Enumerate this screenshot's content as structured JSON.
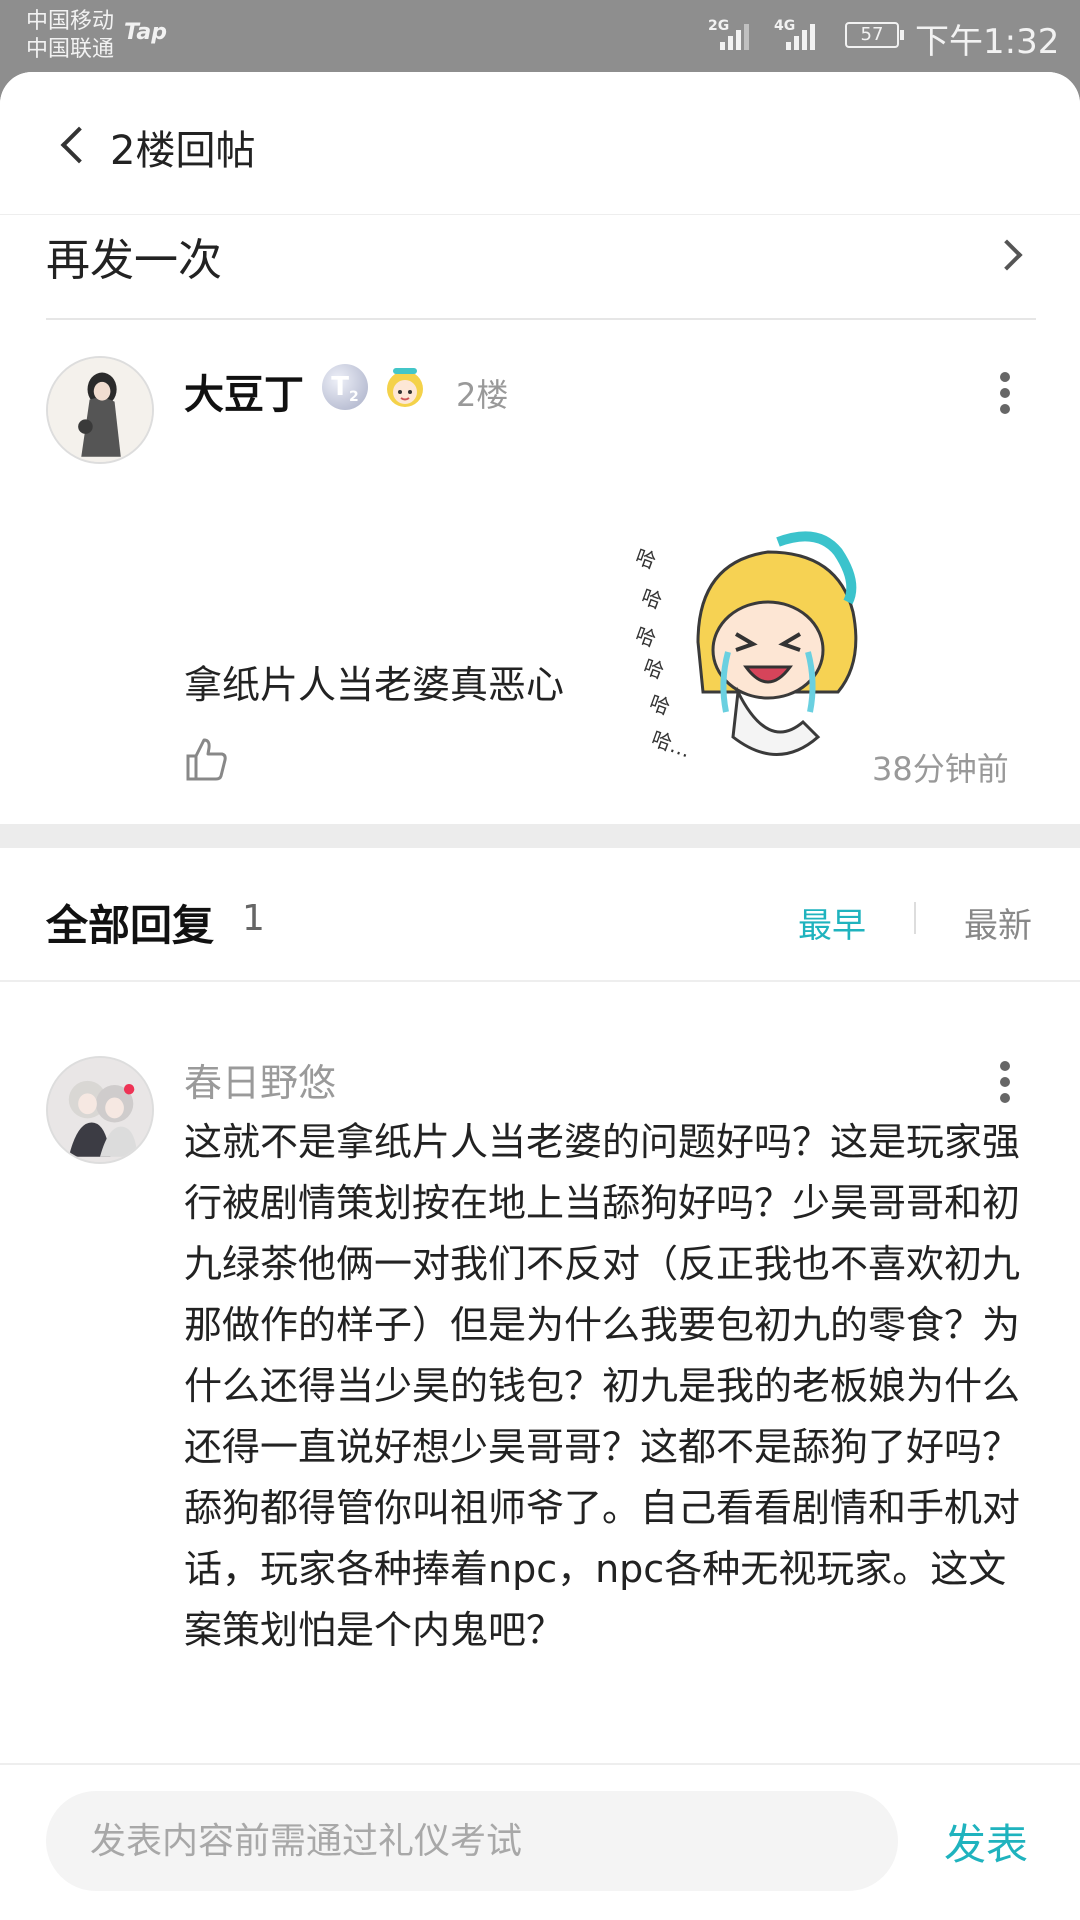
{
  "status_bar": {
    "carrier1": "中国移动",
    "carrier2": "中国联通",
    "app_badge": "Tap",
    "signal1_label": "2G",
    "signal2_label": "4G",
    "battery": "57",
    "time": "下午1:32"
  },
  "header": {
    "title": "2楼回帖",
    "back_icon": "chevron-left-icon"
  },
  "resend": {
    "label": "再发一次",
    "icon": "chevron-right-icon"
  },
  "post": {
    "author": "大豆丁",
    "badge": "T",
    "badge_sub": "2",
    "floor": "2楼",
    "text": "拿纸片人当老婆真恶心",
    "time": "38分钟前",
    "sticker_text": "哈哈哈哈哈哈…"
  },
  "replies": {
    "title": "全部回复",
    "count": "1",
    "sort_earliest": "最早",
    "sort_newest": "最新",
    "items": [
      {
        "author": "春日野悠",
        "text": "这就不是拿纸片人当老婆的问题好吗？这是玩家强行被剧情策划按在地上当舔狗好吗？少昊哥哥和初九绿茶他俩一对我们不反对（反正我也不喜欢初九那做作的样子）但是为什么我要包初九的零食？为什么还得当少昊的钱包？初九是我的老板娘为什么还得一直说好想少昊哥哥？这都不是舔狗了好吗？舔狗都得管你叫祖师爷了。自己看看剧情和手机对话，玩家各种捧着npc，npc各种无视玩家。这文案策划怕是个内鬼吧？"
      }
    ]
  },
  "composer": {
    "placeholder": "发表内容前需通过礼仪考试",
    "send_label": "发表"
  },
  "colors": {
    "accent": "#1fb3be",
    "status_bar_bg": "#8e8e8e",
    "muted": "#999999"
  }
}
